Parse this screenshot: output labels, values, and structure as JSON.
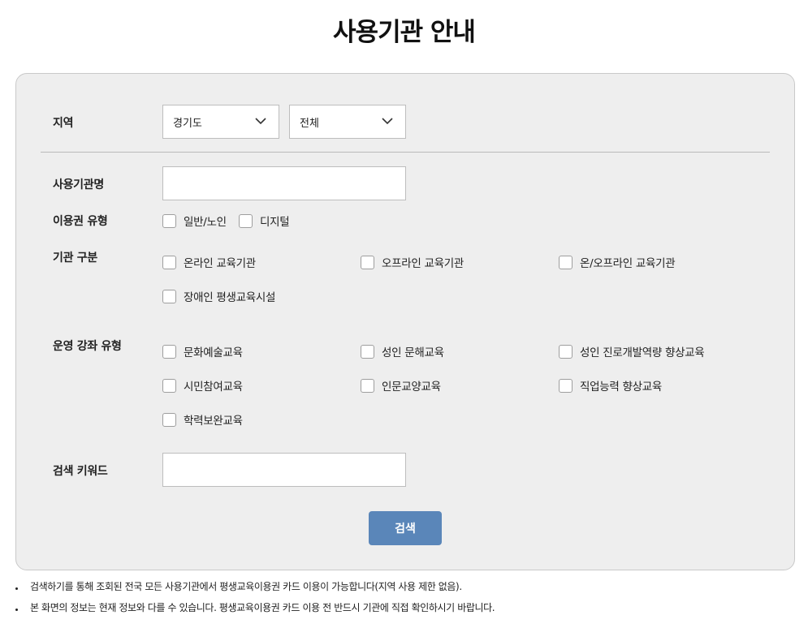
{
  "page": {
    "title": "사용기관 안내"
  },
  "form": {
    "region": {
      "label": "지역",
      "province": {
        "value": "경기도",
        "icon": "chevron-down-icon"
      },
      "city": {
        "value": "전체",
        "icon": "chevron-down-icon"
      }
    },
    "institution_name": {
      "label": "사용기관명",
      "value": "",
      "placeholder": ""
    },
    "voucher_type": {
      "label": "이용권 유형",
      "options": [
        {
          "label": "일반/노인",
          "checked": false
        },
        {
          "label": "디지털",
          "checked": false
        }
      ]
    },
    "institution_category": {
      "label": "기관 구분",
      "options": [
        {
          "label": "온라인 교육기관",
          "checked": false
        },
        {
          "label": "오프라인 교육기관",
          "checked": false
        },
        {
          "label": "온/오프라인 교육기관",
          "checked": false
        },
        {
          "label": "장애인 평생교육시설",
          "checked": false
        }
      ]
    },
    "course_type": {
      "label": "운영 강좌 유형",
      "options": [
        {
          "label": "문화예술교육",
          "checked": false
        },
        {
          "label": "성인 문해교육",
          "checked": false
        },
        {
          "label": "성인 진로개발역량 향상교육",
          "checked": false
        },
        {
          "label": "시민참여교육",
          "checked": false
        },
        {
          "label": "인문교양교육",
          "checked": false
        },
        {
          "label": "직업능력 향상교육",
          "checked": false
        },
        {
          "label": "학력보완교육",
          "checked": false
        }
      ]
    },
    "keyword": {
      "label": "검색 키워드",
      "value": "",
      "placeholder": ""
    },
    "search_button": "검색"
  },
  "notes": [
    "검색하기를 통해 조회된 전국 모든 사용기관에서 평생교육이용권 카드 이용이 가능합니다(지역 사용 제한 없음).",
    "본 화면의 정보는 현재 정보와 다를 수 있습니다. 평생교육이용권 카드 이용 전 반드시 기관에 직접 확인하시기 바랍니다."
  ],
  "colors": {
    "panel_bg": "#eeeeee",
    "button_bg": "#5a86b9",
    "page_bg": "#ffffff"
  }
}
